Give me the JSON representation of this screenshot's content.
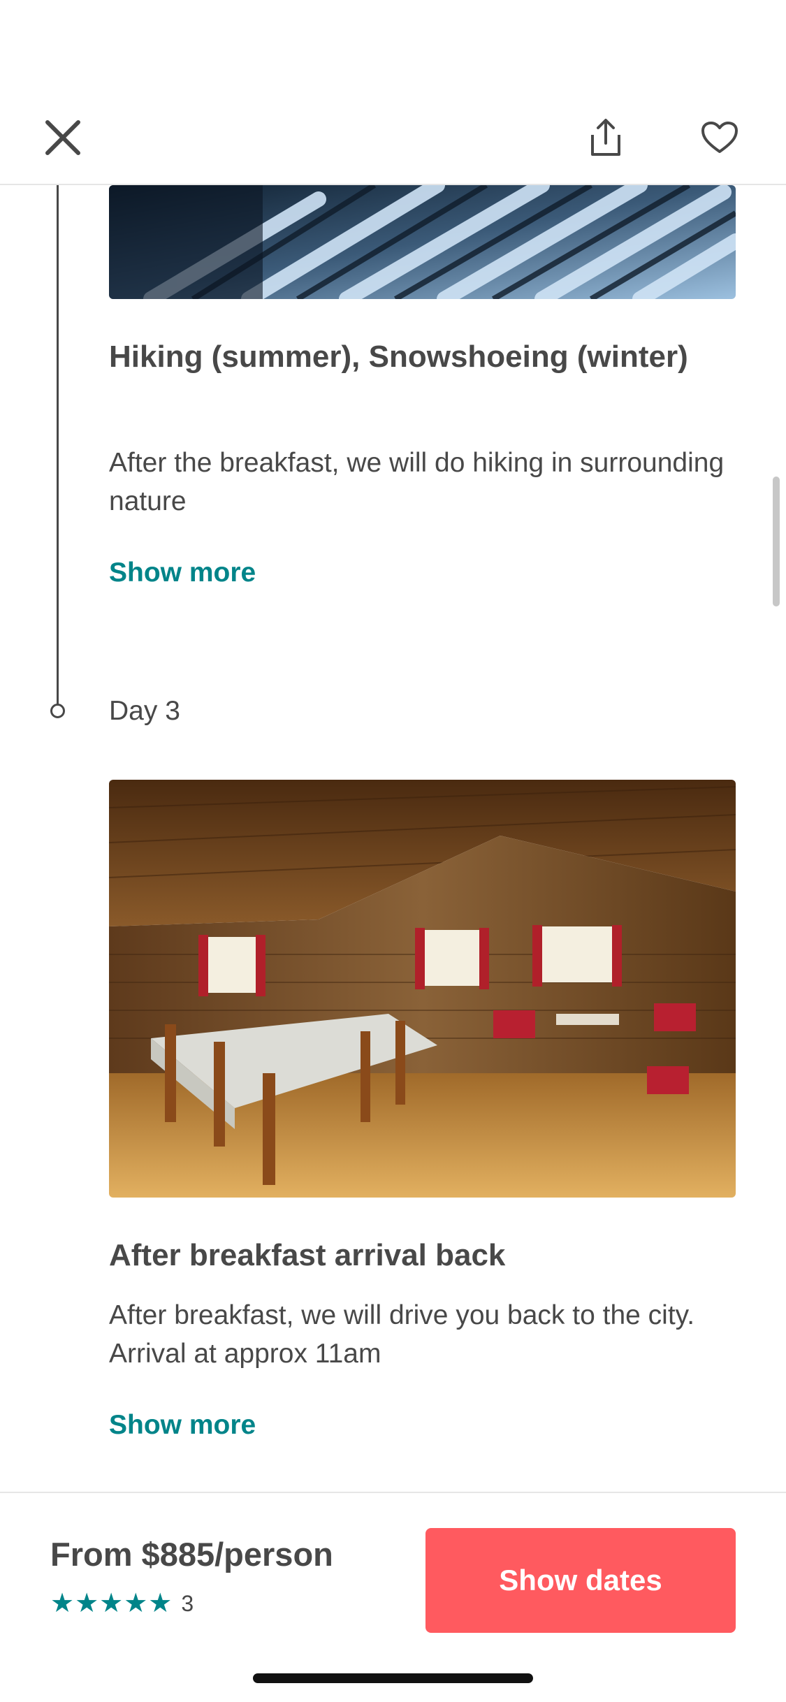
{
  "header": {
    "close_icon": "close-icon",
    "share_icon": "share-icon",
    "favorite_icon": "heart-icon"
  },
  "itinerary": [
    {
      "title": "Hiking (summer), Snowshoeing (winter)",
      "description": "After the breakfast, we will do hiking in surrounding nature",
      "show_more": "Show more"
    },
    {
      "day": "Day 3",
      "title": "After breakfast arrival back",
      "description": "After breakfast, we will drive you back to the city. Arrival at approx 11am",
      "show_more": "Show more"
    }
  ],
  "footer": {
    "price": "From $885/person",
    "stars": "★★★★★",
    "rating_count": "3",
    "cta_label": "Show dates"
  },
  "colors": {
    "accent": "#008489",
    "cta": "#ff5a5f",
    "text": "#484848"
  }
}
